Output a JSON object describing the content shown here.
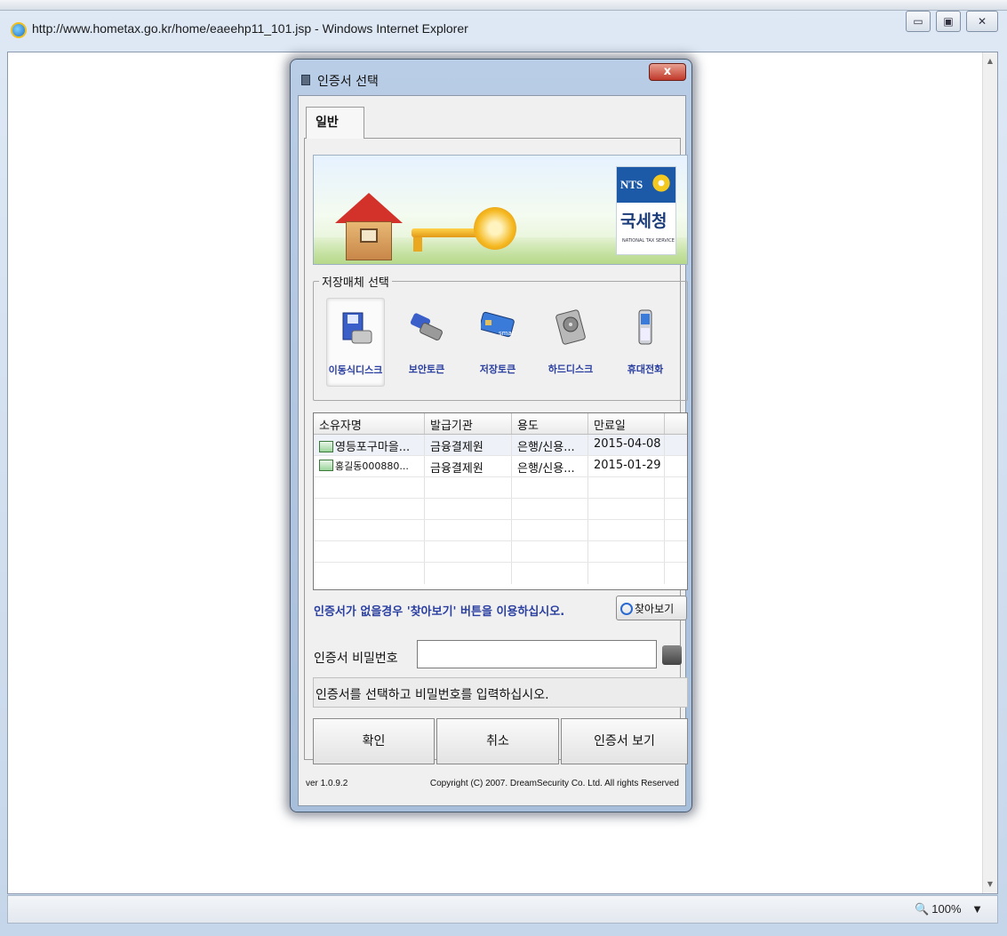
{
  "browser": {
    "title": "http://www.hometax.go.kr/home/eaeehp11_101.jsp - Windows Internet Explorer",
    "window_buttons": {
      "minimize": "▭",
      "maximize": "▣",
      "close": "✕"
    },
    "zoom": "100%",
    "zoom_arrow": "▼"
  },
  "dialog": {
    "title": "인증서 선택",
    "close_label": "x",
    "tab": "일반",
    "banner": {
      "logo_en": "NTS",
      "logo_kr": "국세청",
      "logo_sub": "NATIONAL TAX SERVICE"
    },
    "media_group_label": "저장매체 선택",
    "media": [
      {
        "label": "이동식디스크",
        "icon": "usb-disk-icon",
        "selected": true
      },
      {
        "label": "보안토큰",
        "icon": "security-token-icon",
        "selected": false
      },
      {
        "label": "저장토큰",
        "icon": "smartcard-icon",
        "selected": false
      },
      {
        "label": "하드디스크",
        "icon": "hard-disk-icon",
        "selected": false
      },
      {
        "label": "휴대전화",
        "icon": "mobile-phone-icon",
        "selected": false
      }
    ],
    "smartcard_text": "smart card",
    "columns": [
      "소유자명",
      "발급기관",
      "용도",
      "만료일"
    ],
    "rows": [
      {
        "owner": "영등포구마을...",
        "issuer": "금융결제원",
        "usage": "은행/신용...",
        "expiry": "2015-04-08"
      },
      {
        "owner": "홍길동000880...",
        "issuer": "금융결제원",
        "usage": "은행/신용...",
        "expiry": "2015-01-29"
      }
    ],
    "hint": "인증서가 없을경우 '찾아보기' 버튼을 이용하십시오.",
    "find_button": "찾아보기",
    "password_label": "인증서 비밀번호",
    "password_value": "",
    "status_message": "인증서를 선택하고 비밀번호를 입력하십시오.",
    "buttons": {
      "ok": "확인",
      "cancel": "취소",
      "view": "인증서 보기"
    },
    "version": "ver 1.0.9.2",
    "copyright": "Copyright (C) 2007. DreamSecurity Co. Ltd. All rights Reserved"
  },
  "colors": {
    "hint_text": "#2a3fa0",
    "close_button": "#c0392b",
    "nts_blue": "#1c5aa8"
  }
}
